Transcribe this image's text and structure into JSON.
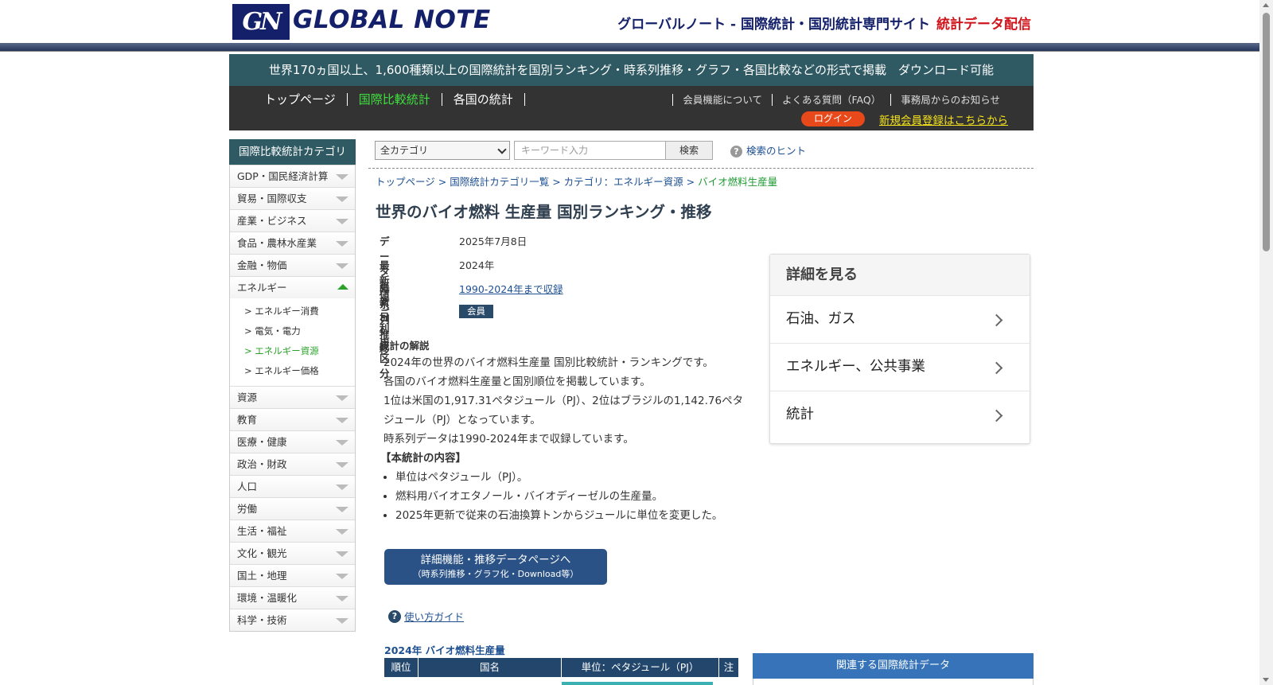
{
  "header": {
    "logo_mark": "GN",
    "logo_text": "GLOBAL NOTE",
    "tagline": "グローバルノート - 国際統計・国別統計専門サイト",
    "tagline_red": "統計データ配信"
  },
  "nav": {
    "banner": "世界170ヵ国以上、1,600種類以上の国際統計を国別ランキング・時系列推移・グラフ・各国比較などの形式で掲載　ダウンロード可能",
    "links": [
      "トップページ",
      "国際比較統計",
      "各国の統計"
    ],
    "right_links": [
      "会員機能について",
      "よくある質問（FAQ）",
      "事務局からのお知らせ"
    ],
    "login": "ログイン",
    "register": "新規会員登録はこちらから"
  },
  "sidebar": {
    "title": "国際比較統計カテゴリ",
    "items_before": [
      "GDP・国民経済計算",
      "貿易・国際収支",
      "産業・ビジネス",
      "食品・農林水産業",
      "金融・物価"
    ],
    "open_item": "エネルギー",
    "sub_items": [
      "> エネルギー消費",
      "> 電気・電力",
      "> エネルギー資源",
      "> エネルギー価格"
    ],
    "items_after": [
      "資源",
      "教育",
      "医療・健康",
      "政治・財政",
      "人口",
      "労働",
      "生活・福祉",
      "文化・観光",
      "国土・地理",
      "環境・温暖化",
      "科学・技術"
    ]
  },
  "search": {
    "category": "全カテゴリ",
    "placeholder": "キーワード入力",
    "button": "検索",
    "hint": "検索のヒント"
  },
  "breadcrumb": {
    "items": [
      "トップページ",
      "国際統計カテゴリ一覧",
      "カテゴリ：エネルギー資源"
    ],
    "current": "バイオ燃料生産量"
  },
  "page": {
    "title": "世界のバイオ燃料 生産量 国別ランキング・推移"
  },
  "info": {
    "updated_label": "データ更新日",
    "updated": "2025年7月8日",
    "latest_label": "最新値",
    "latest": "2024年",
    "series_label": "時系列推移",
    "series": "1990-2024年まで収録",
    "usage_label": "ご利用区分",
    "usage": "会員"
  },
  "explanation": {
    "title": "統計の解説",
    "lines": [
      "2024年の世界のバイオ燃料生産量 国別比較統計・ランキングです。",
      "各国のバイオ燃料生産量と国別順位を掲載しています。",
      "1位は米国の1,917.31ペタジュール（PJ）、2位はブラジルの1,142.76ペタジュール（PJ）となっています。",
      "時系列データは1990-2024年まで収録しています。"
    ],
    "contents_title": "【本統計の内容】",
    "bullets": [
      "単位はペタジュール（PJ）。",
      "燃料用バイオエタノール・バイオディーゼルの生産量。",
      "2025年更新で従来の石油換算トンからジュールに単位を変更した。"
    ]
  },
  "detail_button": {
    "line1": "詳細機能・推移データページへ",
    "line2": "（時系列推移・グラフ化・Download等）"
  },
  "guide": "使い方ガイド",
  "table": {
    "title": "2024年 バイオ燃料生産量",
    "headers": [
      "順位",
      "国名",
      "単位：ペタジュール（PJ）",
      "注"
    ]
  },
  "detail_card": {
    "title": "詳細を見る",
    "items": [
      "石油、ガス",
      "エネルギー、公共事業",
      "統計"
    ]
  },
  "related": "関連する国際統計データ"
}
